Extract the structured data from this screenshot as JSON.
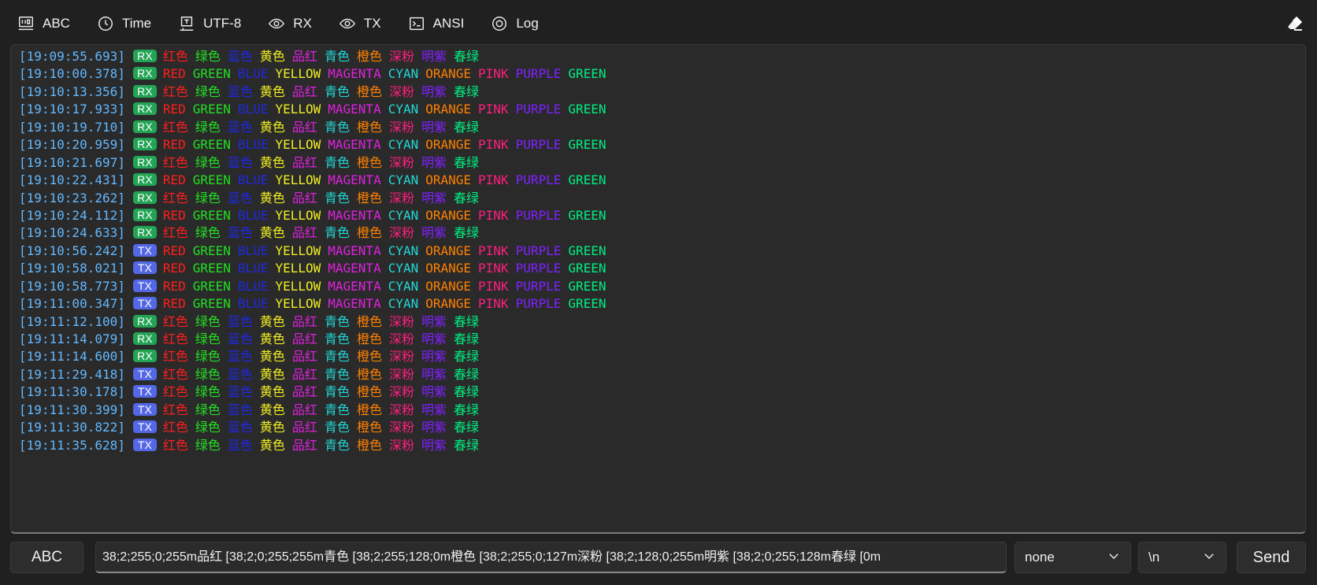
{
  "toolbar": {
    "items": [
      {
        "label": "ABC",
        "icon": "binary-icon"
      },
      {
        "label": "Time",
        "icon": "clock-icon"
      },
      {
        "label": "UTF-8",
        "icon": "encoding-icon"
      },
      {
        "label": "RX",
        "icon": "eye-icon"
      },
      {
        "label": "TX",
        "icon": "eye-icon"
      },
      {
        "label": "ANSI",
        "icon": "terminal-icon"
      },
      {
        "label": "Log",
        "icon": "record-icon"
      }
    ],
    "clear_icon": "eraser-icon"
  },
  "colors": {
    "timestamp": "#62b8ff",
    "rx_badge": "#23a455",
    "tx_badge": "#5468e6",
    "palette": [
      "#ff1e1e",
      "#22e022",
      "#1f28e0",
      "#f0ee22",
      "#e020e0",
      "#22d6d6",
      "#ff8000",
      "#ff1f7f",
      "#8020ff",
      "#00ee80"
    ]
  },
  "words_cn": [
    "红色",
    "绿色",
    "蓝色",
    "黄色",
    "品红",
    "青色",
    "橙色",
    "深粉",
    "明紫",
    "春绿"
  ],
  "words_en": [
    "RED",
    "GREEN",
    "BLUE",
    "YELLOW",
    "MAGENTA",
    "CYAN",
    "ORANGE",
    "PINK",
    "PURPLE",
    "GREEN"
  ],
  "log": [
    {
      "ts": "[19:09:55.693]",
      "dir": "RX",
      "lang": "cn"
    },
    {
      "ts": "[19:10:00.378]",
      "dir": "RX",
      "lang": "en"
    },
    {
      "ts": "[19:10:13.356]",
      "dir": "RX",
      "lang": "cn"
    },
    {
      "ts": "[19:10:17.933]",
      "dir": "RX",
      "lang": "en"
    },
    {
      "ts": "[19:10:19.710]",
      "dir": "RX",
      "lang": "cn"
    },
    {
      "ts": "[19:10:20.959]",
      "dir": "RX",
      "lang": "en"
    },
    {
      "ts": "[19:10:21.697]",
      "dir": "RX",
      "lang": "cn"
    },
    {
      "ts": "[19:10:22.431]",
      "dir": "RX",
      "lang": "en"
    },
    {
      "ts": "[19:10:23.262]",
      "dir": "RX",
      "lang": "cn"
    },
    {
      "ts": "[19:10:24.112]",
      "dir": "RX",
      "lang": "en"
    },
    {
      "ts": "[19:10:24.633]",
      "dir": "RX",
      "lang": "cn"
    },
    {
      "ts": "[19:10:56.242]",
      "dir": "TX",
      "lang": "en"
    },
    {
      "ts": "[19:10:58.021]",
      "dir": "TX",
      "lang": "en"
    },
    {
      "ts": "[19:10:58.773]",
      "dir": "TX",
      "lang": "en"
    },
    {
      "ts": "[19:11:00.347]",
      "dir": "TX",
      "lang": "en"
    },
    {
      "ts": "[19:11:12.100]",
      "dir": "RX",
      "lang": "cn"
    },
    {
      "ts": "[19:11:14.079]",
      "dir": "RX",
      "lang": "cn"
    },
    {
      "ts": "[19:11:14.600]",
      "dir": "RX",
      "lang": "cn"
    },
    {
      "ts": "[19:11:29.418]",
      "dir": "TX",
      "lang": "cn"
    },
    {
      "ts": "[19:11:30.178]",
      "dir": "TX",
      "lang": "cn"
    },
    {
      "ts": "[19:11:30.399]",
      "dir": "TX",
      "lang": "cn"
    },
    {
      "ts": "[19:11:30.822]",
      "dir": "TX",
      "lang": "cn"
    },
    {
      "ts": "[19:11:35.628]",
      "dir": "TX",
      "lang": "cn"
    }
  ],
  "bottom": {
    "mode_label": "ABC",
    "input_value": "38;2;255;0;255m品红  [38;2;0;255;255m青色  [38;2;255;128;0m橙色  [38;2;255;0;127m深粉  [38;2;128;0;255m明紫  [38;2;0;255;128m春绿  [0m",
    "checksum_value": "none",
    "line_ending_value": "\\n",
    "send_label": "Send"
  }
}
